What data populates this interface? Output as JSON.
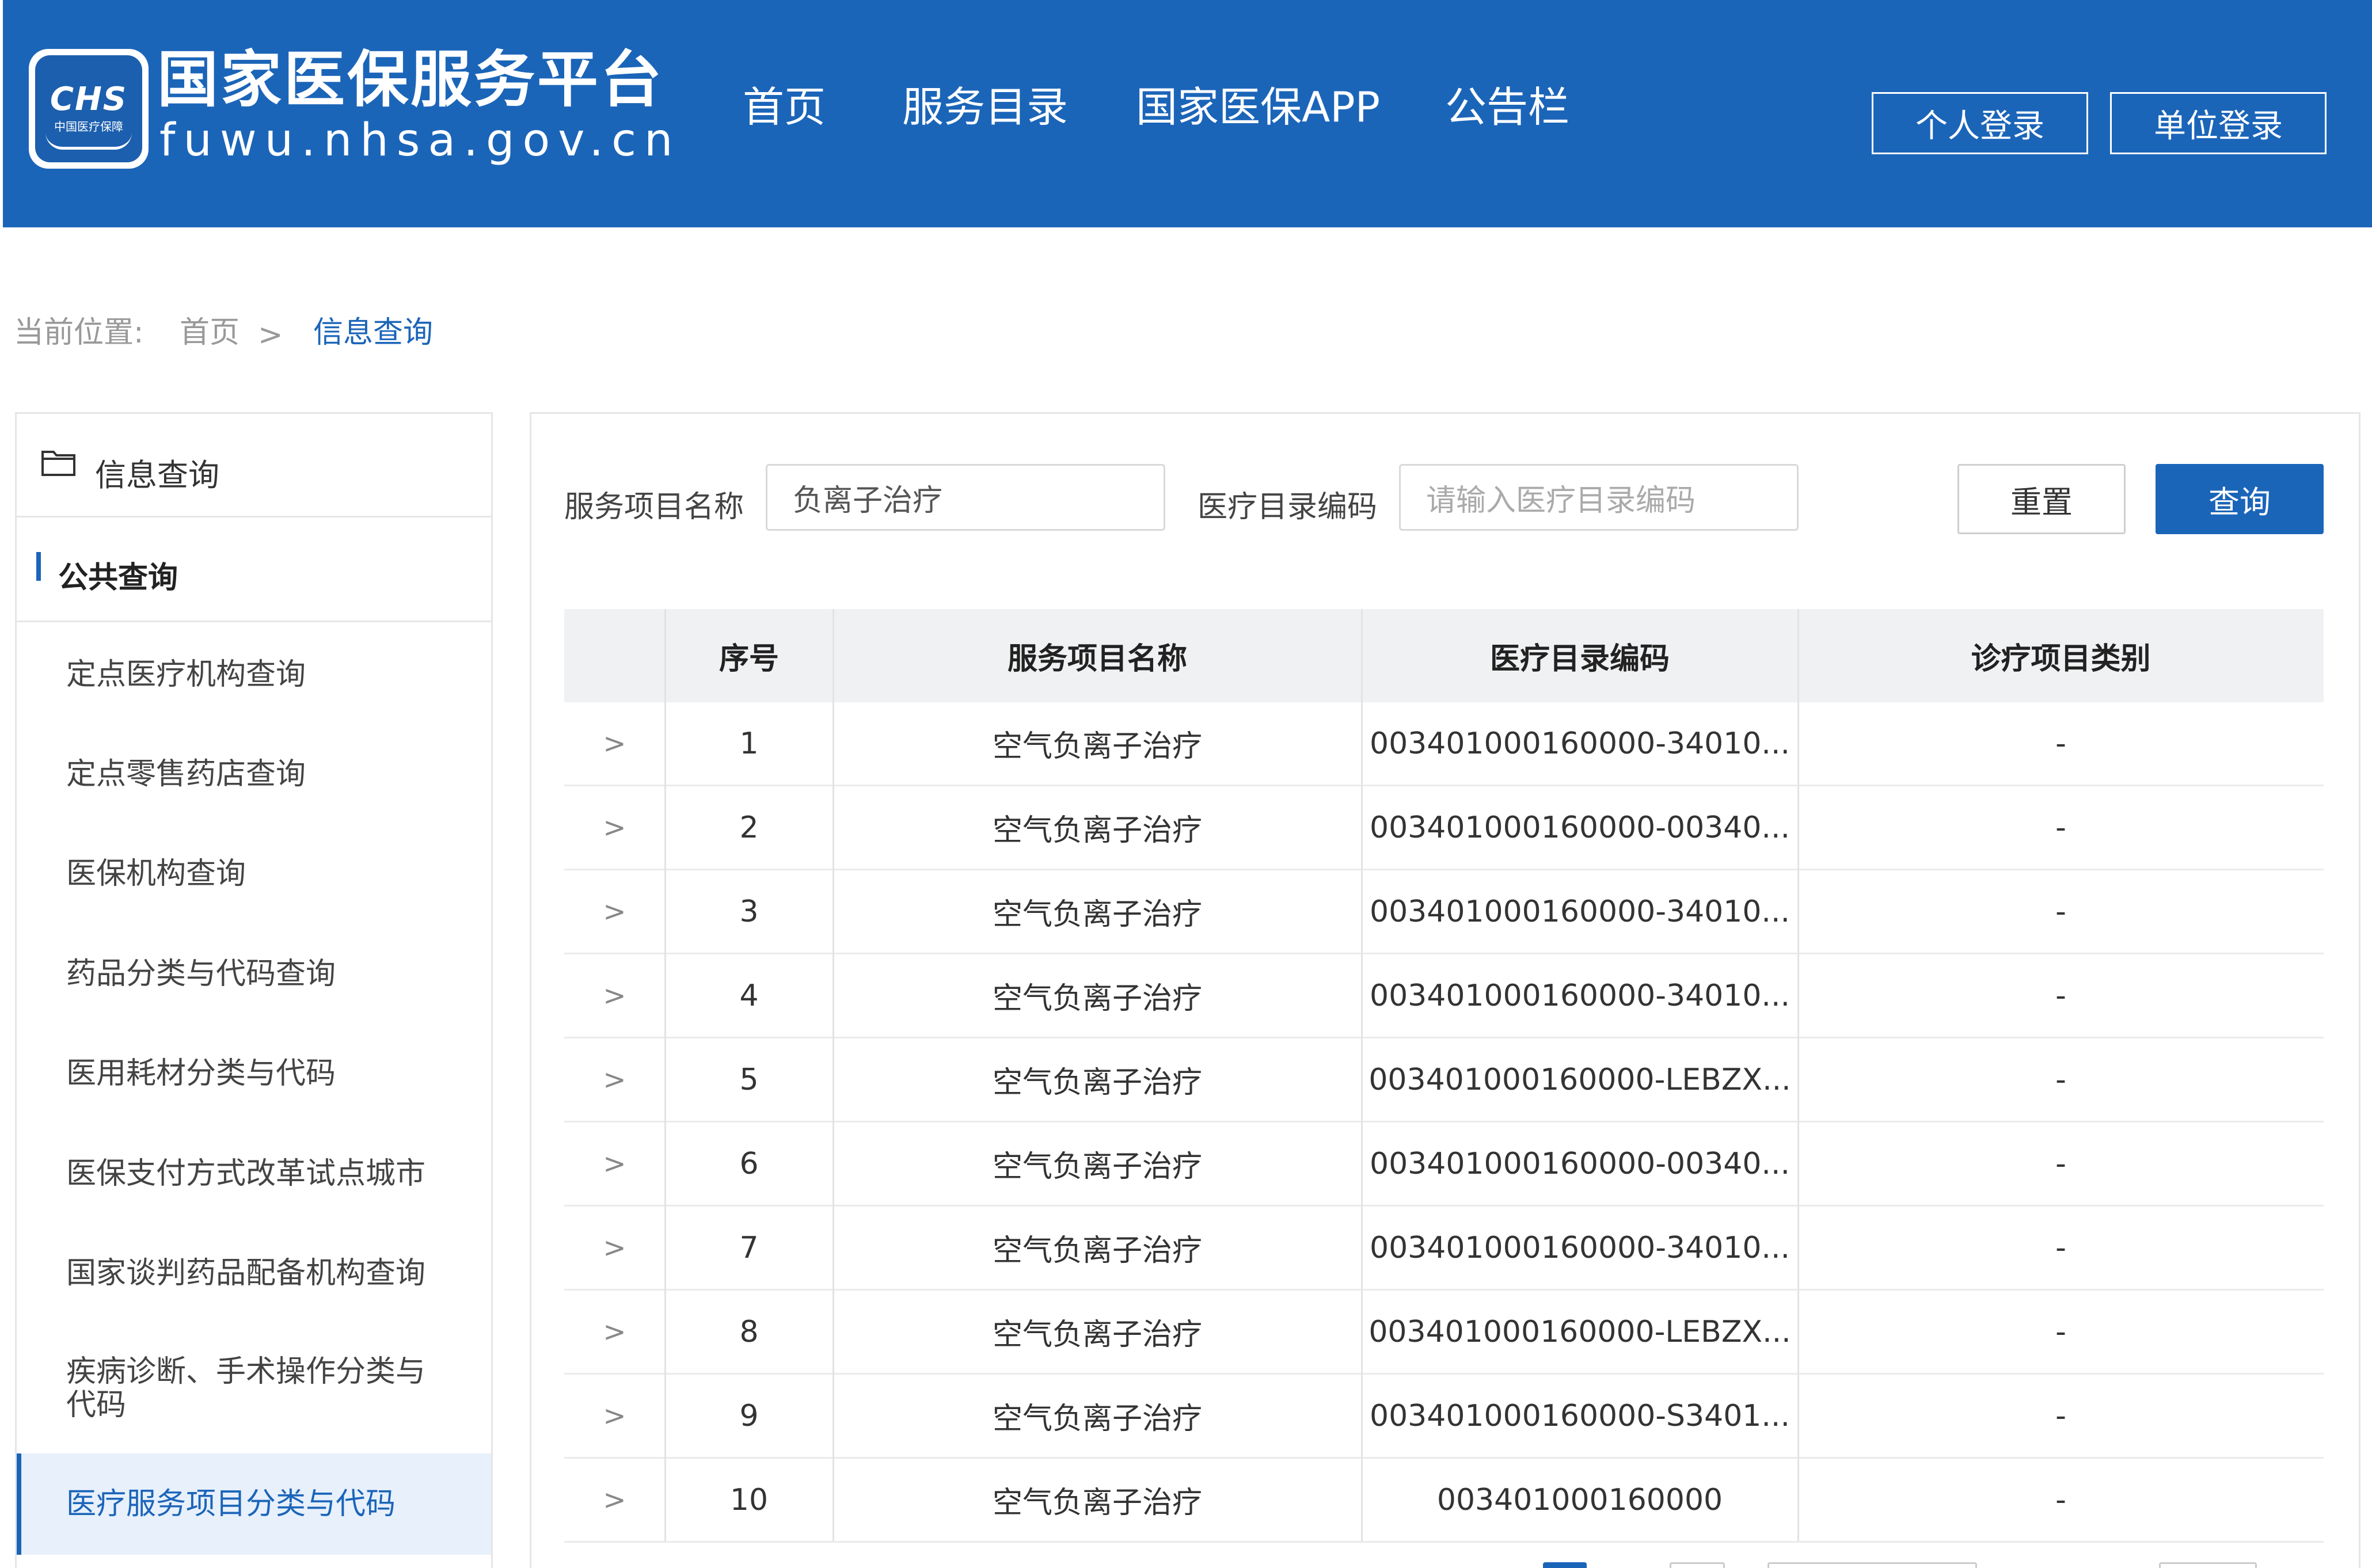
{
  "header": {
    "logo_text": "CHS",
    "logo_sub": "中国医疗保障",
    "title": "国家医保服务平台",
    "url": "fuwu.nhsa.gov.cn",
    "nav": [
      "首页",
      "服务目录",
      "国家医保APP",
      "公告栏"
    ],
    "login_personal": "个人登录",
    "login_unit": "单位登录"
  },
  "breadcrumb": {
    "prefix": "当前位置:",
    "home": "首页",
    "separator": ">",
    "current": "信息查询"
  },
  "sidebar": {
    "head": "信息查询",
    "section": "公共查询",
    "items": [
      "定点医疗机构查询",
      "定点零售药店查询",
      "医保机构查询",
      "药品分类与代码查询",
      "医用耗材分类与代码",
      "医保支付方式改革试点城市",
      "国家谈判药品配备机构查询",
      "疾病诊断、手术操作分类与代码",
      "医疗服务项目分类与代码"
    ],
    "active_index": 8
  },
  "filters": {
    "name_label": "服务项目名称",
    "name_value": "负离子治疗",
    "code_label": "医疗目录编码",
    "code_placeholder": "请输入医疗目录编码",
    "reset_label": "重置",
    "query_label": "查询"
  },
  "table": {
    "columns": [
      "序号",
      "服务项目名称",
      "医疗目录编码",
      "诊疗项目类别"
    ],
    "rows": [
      {
        "expand": ">",
        "no": "1",
        "name": "空气负离子治疗",
        "code": "003401000160000-34010...",
        "category": "-"
      },
      {
        "expand": ">",
        "no": "2",
        "name": "空气负离子治疗",
        "code": "003401000160000-00340...",
        "category": "-"
      },
      {
        "expand": ">",
        "no": "3",
        "name": "空气负离子治疗",
        "code": "003401000160000-34010...",
        "category": "-"
      },
      {
        "expand": ">",
        "no": "4",
        "name": "空气负离子治疗",
        "code": "003401000160000-34010...",
        "category": "-"
      },
      {
        "expand": ">",
        "no": "5",
        "name": "空气负离子治疗",
        "code": "003401000160000-LEBZX...",
        "category": "-"
      },
      {
        "expand": ">",
        "no": "6",
        "name": "空气负离子治疗",
        "code": "003401000160000-00340...",
        "category": "-"
      },
      {
        "expand": ">",
        "no": "7",
        "name": "空气负离子治疗",
        "code": "003401000160000-34010...",
        "category": "-"
      },
      {
        "expand": ">",
        "no": "8",
        "name": "空气负离子治疗",
        "code": "003401000160000-LEBZX...",
        "category": "-"
      },
      {
        "expand": ">",
        "no": "9",
        "name": "空气负离子治疗",
        "code": "003401000160000-S3401...",
        "category": "-"
      },
      {
        "expand": ">",
        "no": "10",
        "name": "空气负离子治疗",
        "code": "003401000160000",
        "category": "-"
      }
    ]
  },
  "colors": {
    "brand": "#1b65b9",
    "active_bg": "#e8f0fb",
    "header_row_bg": "#f0f1f3"
  }
}
